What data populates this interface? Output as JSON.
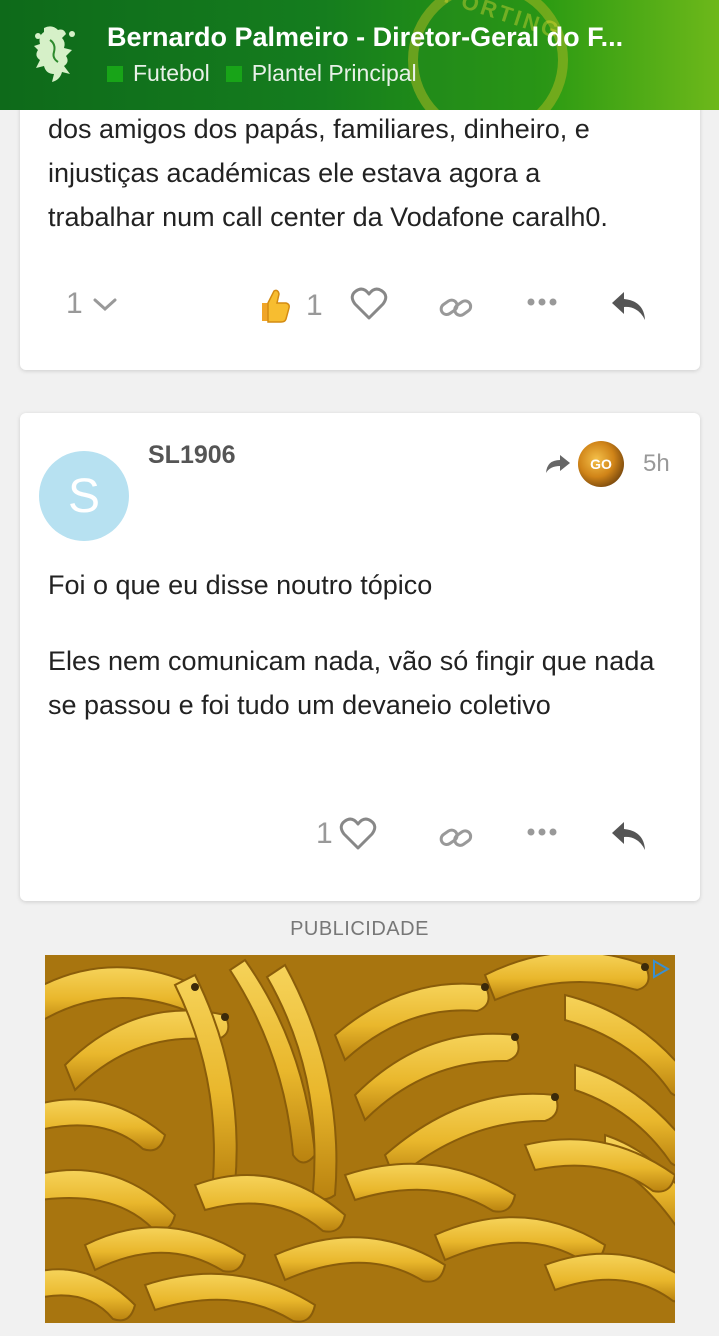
{
  "header": {
    "title": "Bernardo Palmeiro - Diretor-Geral do F...",
    "categories": [
      {
        "label": "Futebol",
        "color": "#18a418"
      },
      {
        "label": "Plantel Principal",
        "color": "#18a418"
      }
    ],
    "crest_text": "SPORTING"
  },
  "posts": [
    {
      "text_lines": [
        "dos amigos dos papás, familiares, dinheiro, e",
        "injustiças académicas ele estava agora a",
        "trabalhar num call center da Vodafone caralh0."
      ],
      "replies_count": "1",
      "reaction_count": "1",
      "reaction_icon": "thumbs-up-emoji"
    },
    {
      "username": "SL1906",
      "avatar_letter": "S",
      "reply_to_avatar_text": "GO",
      "time": "5h",
      "paragraphs": [
        "Foi o que eu disse noutro tópico",
        "Eles nem comunicam nada, vão só fingir que nada se passou e foi tudo um devaneio coletivo"
      ],
      "like_count": "1"
    }
  ],
  "ad": {
    "label": "PUBLICIDADE",
    "image": "bananas"
  },
  "colors": {
    "header_green": "#157d1e",
    "background": "#f1f1f1",
    "avatar_blue": "#b7e1f1",
    "icon_gray": "#888888"
  }
}
